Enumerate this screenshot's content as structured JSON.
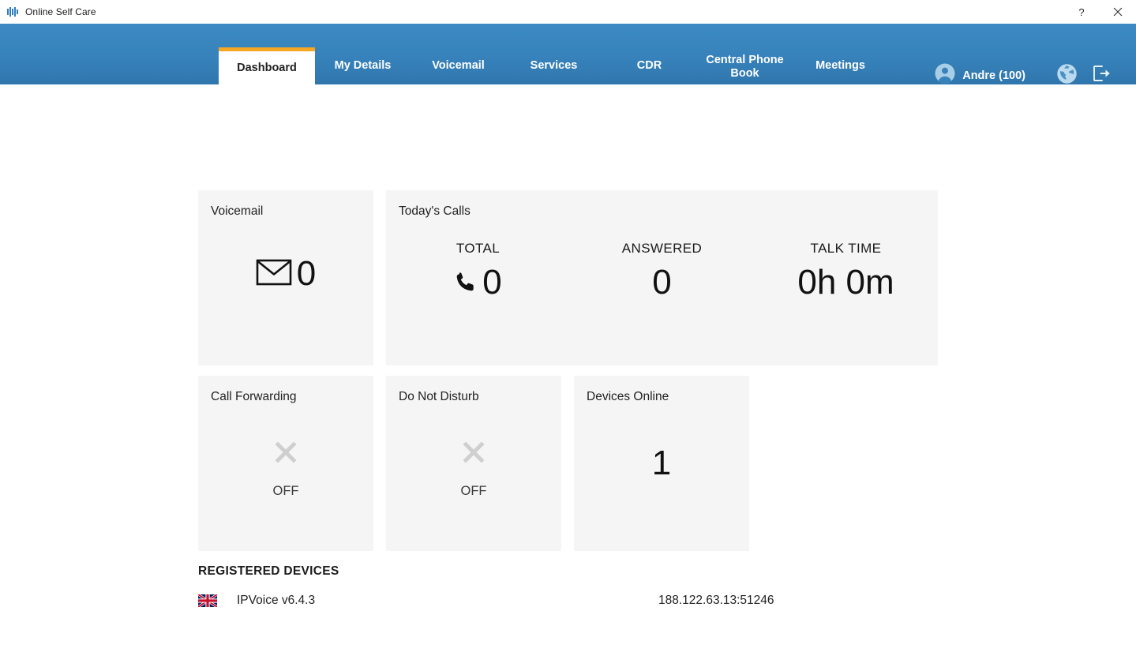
{
  "window": {
    "title": "Online Self Care",
    "icon": "app-bars-icon",
    "help_label": "?",
    "close_label": "×"
  },
  "nav": {
    "tabs": [
      {
        "label": "Dashboard",
        "active": true
      },
      {
        "label": "My Details",
        "active": false
      },
      {
        "label": "Voicemail",
        "active": false
      },
      {
        "label": "Services",
        "active": false
      },
      {
        "label": "CDR",
        "active": false
      },
      {
        "label": "Central Phone Book",
        "active": false
      },
      {
        "label": "Meetings",
        "active": false
      }
    ],
    "user": {
      "name": "Andre (100)",
      "avatar_icon": "user-avatar-icon"
    },
    "language_icon": "globe-icon",
    "logout_icon": "logout-icon",
    "accent_color": "#f5a623",
    "bar_color": "#3782bb"
  },
  "cards": {
    "voicemail": {
      "title": "Voicemail",
      "icon": "envelope-icon",
      "count": "0"
    },
    "todays_calls": {
      "title": "Today's Calls",
      "stats": [
        {
          "label": "TOTAL",
          "value": "0",
          "icon": "phone-icon"
        },
        {
          "label": "ANSWERED",
          "value": "0",
          "icon": ""
        },
        {
          "label": "TALK TIME",
          "value": "0h 0m",
          "icon": ""
        }
      ]
    },
    "call_forwarding": {
      "title": "Call Forwarding",
      "icon": "x-mark-icon",
      "state": "OFF"
    },
    "do_not_disturb": {
      "title": "Do Not Disturb",
      "icon": "x-mark-icon",
      "state": "OFF"
    },
    "devices_online": {
      "title": "Devices Online",
      "count": "1"
    }
  },
  "registered_devices": {
    "heading": "REGISTERED DEVICES",
    "rows": [
      {
        "flag": "uk-flag-icon",
        "name": "IPVoice v6.4.3",
        "address": "188.122.63.13:51246"
      }
    ]
  }
}
